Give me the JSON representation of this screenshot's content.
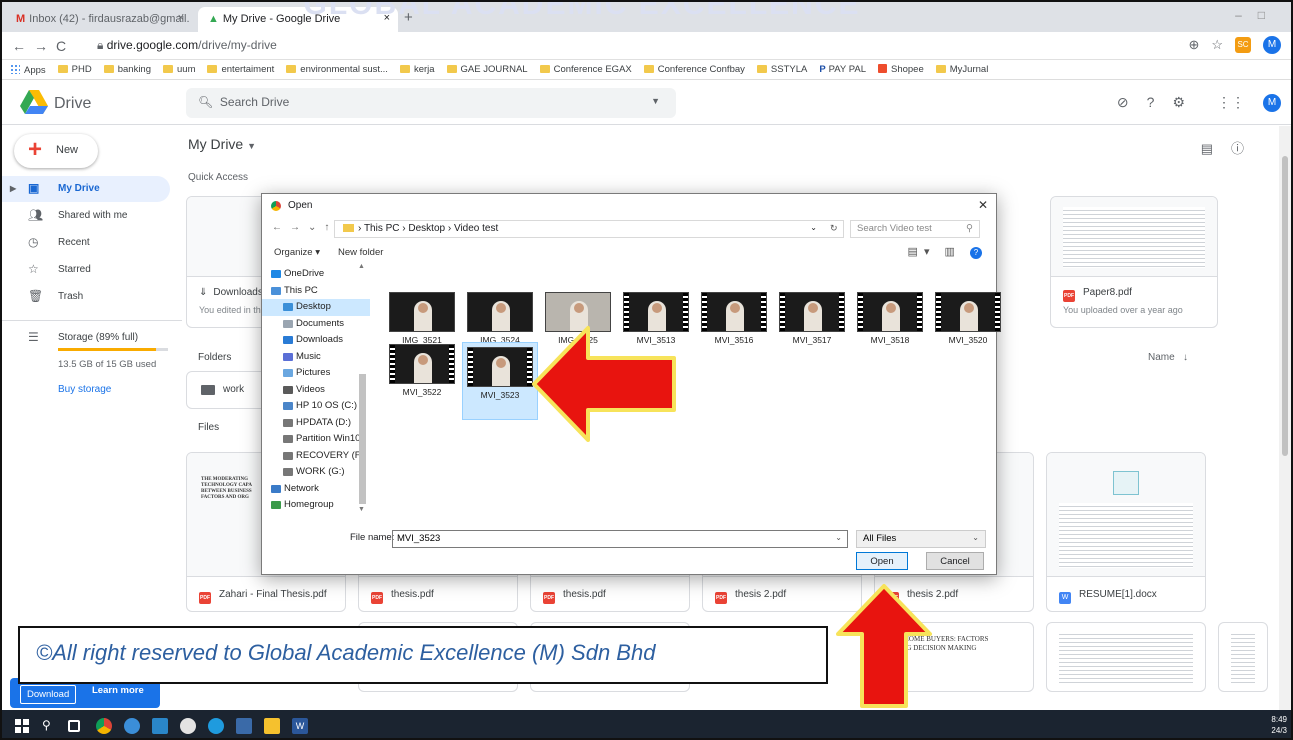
{
  "watermark": "GLOBAL ACADEMIC EXCELLENCE",
  "browser": {
    "tabs": [
      {
        "label": "Inbox (42) - firdausrazab@gmail."
      },
      {
        "label": "My Drive - Google Drive"
      }
    ],
    "url_domain": "drive.google.com",
    "url_path": "/drive/my-drive",
    "profile_initial": "M",
    "ext_label": "SC",
    "bookmarks": [
      "Apps",
      "PHD",
      "banking",
      "uum",
      "entertaiment",
      "environmental sust...",
      "kerja",
      "GAE JOURNAL",
      "Conference EGAX",
      "Conference Confbay",
      "SSTYLA",
      "PAY PAL",
      "Shopee",
      "MyJurnal"
    ]
  },
  "drive": {
    "title": "Drive",
    "search_placeholder": "Search Drive",
    "new_label": "New",
    "sidebar": [
      {
        "label": "My Drive",
        "icon": "drive-folder-icon",
        "active": true
      },
      {
        "label": "Shared with me",
        "icon": "people-icon"
      },
      {
        "label": "Recent",
        "icon": "clock-icon"
      },
      {
        "label": "Starred",
        "icon": "star-icon"
      },
      {
        "label": "Trash",
        "icon": "trash-icon"
      }
    ],
    "storage_label": "Storage (89% full)",
    "storage_used": "13.5 GB of 15 GB used",
    "storage_fraction": 0.89,
    "buy_storage": "Buy storage",
    "download_label": "Download",
    "learn_more_label": "Learn more",
    "main_title": "My Drive",
    "quick_access": "Quick Access",
    "qa_cards": [
      {
        "name": "Downloads.r",
        "sub": "You edited in the p"
      },
      {
        "name": "Paper8.pdf",
        "sub": "You uploaded over a year ago"
      }
    ],
    "folders_label": "Folders",
    "name_sort": "Name",
    "folder": "work",
    "files_label": "Files",
    "files": [
      {
        "name": "Zahari - Final Thesis.pdf",
        "type": "pdf",
        "thumb_lines": [
          "THE MODERATING",
          "TECHNOLOGY CAPA",
          "BETWEEN BUSINESS",
          "FACTORS AND ORG"
        ]
      },
      {
        "name": "thesis.pdf",
        "type": "pdf"
      },
      {
        "name": "thesis.pdf",
        "type": "pdf"
      },
      {
        "name": "thesis 2.pdf",
        "type": "pdf"
      },
      {
        "name": "thesis 2.pdf",
        "type": "pdf"
      },
      {
        "name": "RESUME[1].docx",
        "type": "docx"
      }
    ],
    "row2_thumb_text": [
      "TIME HOME BUYERS: FACTORS",
      "ENCING DECISION MAKING"
    ]
  },
  "dialog": {
    "title": "Open",
    "path": [
      "This PC",
      "Desktop",
      "Video test"
    ],
    "search_placeholder": "Search Video test",
    "organize": "Organize",
    "new_folder": "New folder",
    "tree": [
      {
        "label": "OneDrive",
        "color": "#1e88e5"
      },
      {
        "label": "This PC",
        "color": "#4a90d9"
      },
      {
        "label": "Desktop",
        "color": "#3a8fd8",
        "selected": true
      },
      {
        "label": "Documents",
        "color": "#9aa5b1"
      },
      {
        "label": "Downloads",
        "color": "#2a7bd5"
      },
      {
        "label": "Music",
        "color": "#5b6fd6"
      },
      {
        "label": "Pictures",
        "color": "#6aa7e0"
      },
      {
        "label": "Videos",
        "color": "#5a5a5a"
      },
      {
        "label": "HP 10 OS (C:)",
        "color": "#4b86c9"
      },
      {
        "label": "HPDATA (D:)",
        "color": "#777777"
      },
      {
        "label": "Partition Win10 .",
        "color": "#777777"
      },
      {
        "label": "RECOVERY (F:)",
        "color": "#777777"
      },
      {
        "label": "WORK (G:)",
        "color": "#777777"
      },
      {
        "label": "Network",
        "color": "#3a7bc8"
      },
      {
        "label": "Homegroup",
        "color": "#3a9a4a"
      }
    ],
    "items": [
      {
        "name": "IMG_3521",
        "kind": "photo"
      },
      {
        "name": "IMG_3524",
        "kind": "photo"
      },
      {
        "name": "IMG_3525",
        "kind": "photo-light"
      },
      {
        "name": "MVI_3513",
        "kind": "video"
      },
      {
        "name": "MVI_3516",
        "kind": "video"
      },
      {
        "name": "MVI_3517",
        "kind": "video"
      },
      {
        "name": "MVI_3518",
        "kind": "video"
      },
      {
        "name": "MVI_3520",
        "kind": "video"
      },
      {
        "name": "MVI_3522",
        "kind": "video"
      },
      {
        "name": "MVI_3523",
        "kind": "video",
        "selected": true
      }
    ],
    "file_name_label": "File name:",
    "file_name_value": "MVI_3523",
    "file_type": "All Files",
    "open_label": "Open",
    "cancel_label": "Cancel"
  },
  "copyright": "©All right reserved to Global Academic Excellence (M) Sdn Bhd",
  "taskbar": {
    "time": "8:49",
    "date": "24/3"
  }
}
